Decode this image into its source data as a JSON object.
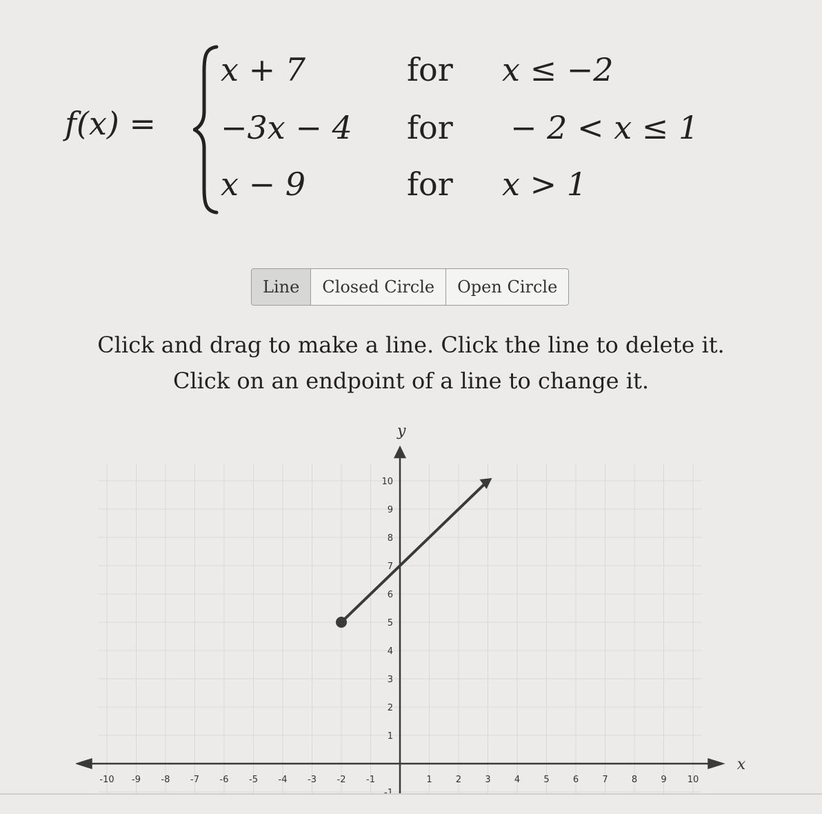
{
  "formula": {
    "lhs": "f(x) =",
    "cases": [
      {
        "expr": "x + 7",
        "for": "for",
        "cond": "x ≤ −2"
      },
      {
        "expr": "−3x − 4",
        "for": "for",
        "cond": "− 2 < x ≤ 1"
      },
      {
        "expr": "x − 9",
        "for": "for",
        "cond": "x > 1"
      }
    ]
  },
  "tools": [
    {
      "label": "Line",
      "active": true
    },
    {
      "label": "Closed Circle",
      "active": false
    },
    {
      "label": "Open Circle",
      "active": false
    }
  ],
  "instructions": {
    "line1": "Click and drag to make a line. Click the line to delete it.",
    "line2": "Click on an endpoint of a line to change it."
  },
  "graph": {
    "x_axis_label": "x",
    "y_axis_label": "y",
    "x_ticks": [
      "-10",
      "-9",
      "-8",
      "-7",
      "-6",
      "-5",
      "-4",
      "-3",
      "-2",
      "-1",
      "1",
      "2",
      "3",
      "4",
      "5",
      "6",
      "7",
      "8",
      "9",
      "10"
    ],
    "y_ticks": [
      "10",
      "9",
      "8",
      "7",
      "6",
      "5",
      "4",
      "3",
      "2",
      "1",
      "-1"
    ],
    "xlim": [
      -10,
      10
    ],
    "ylim": [
      -1,
      10
    ],
    "drawn_line": {
      "from": [
        -2,
        5
      ],
      "to": [
        3,
        10
      ],
      "endpoint_style": "closed"
    },
    "colors": {
      "grid": "#d9d8d5",
      "axis": "#3a3a3a",
      "line": "#3a3a3a"
    }
  }
}
